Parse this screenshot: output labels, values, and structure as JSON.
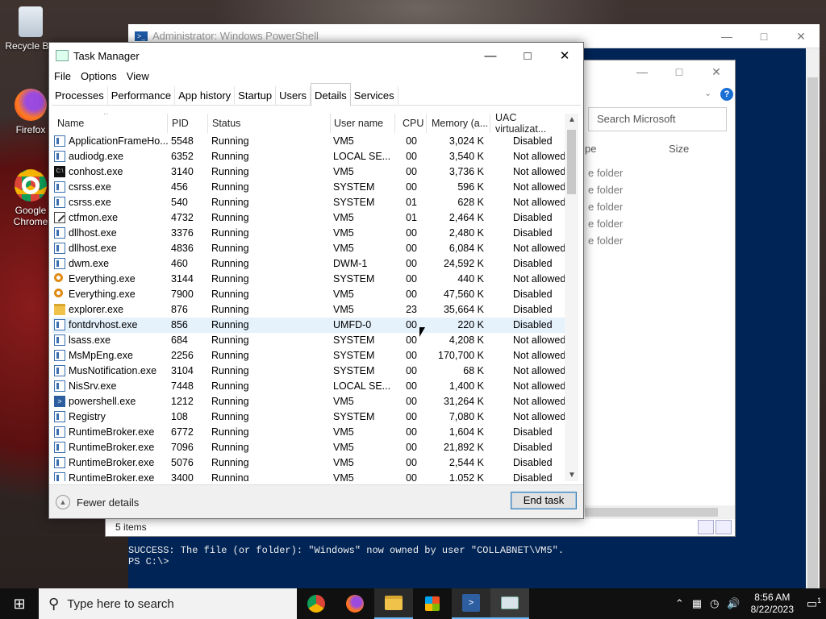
{
  "desktop": {
    "icons": [
      {
        "label": "Recycle Bin"
      },
      {
        "label": "Firefox"
      },
      {
        "label": "Google Chrome"
      }
    ]
  },
  "powershell": {
    "title": "Administrator: Windows PowerShell",
    "output_line1": "SUCCESS: The file (or folder): \"Windows\" now owned by user \"COLLABNET\\VM5\".",
    "output_line2": "PS C:\\>"
  },
  "explorer": {
    "search_placeholder": "Search Microsoft",
    "col_type": "pe",
    "col_size": "Size",
    "rows": [
      "e folder",
      "e folder",
      "e folder",
      "e folder",
      "e folder"
    ],
    "status": "5 items"
  },
  "taskmanager": {
    "title": "Task Manager",
    "menu": [
      "File",
      "Options",
      "View"
    ],
    "tabs": [
      "Processes",
      "Performance",
      "App history",
      "Startup",
      "Users",
      "Details",
      "Services"
    ],
    "active_tab": "Details",
    "columns": [
      "Name",
      "PID",
      "Status",
      "User name",
      "CPU",
      "Memory (a...",
      "UAC virtualizat..."
    ],
    "rows": [
      {
        "icon": "app",
        "name": "ApplicationFrameHo...",
        "pid": "5548",
        "status": "Running",
        "user": "VM5",
        "cpu": "00",
        "mem": "3,024 K",
        "uac": "Disabled"
      },
      {
        "icon": "app",
        "name": "audiodg.exe",
        "pid": "6352",
        "status": "Running",
        "user": "LOCAL SE...",
        "cpu": "00",
        "mem": "3,540 K",
        "uac": "Not allowed"
      },
      {
        "icon": "cmd",
        "name": "conhost.exe",
        "pid": "3140",
        "status": "Running",
        "user": "VM5",
        "cpu": "00",
        "mem": "3,736 K",
        "uac": "Not allowed"
      },
      {
        "icon": "app",
        "name": "csrss.exe",
        "pid": "456",
        "status": "Running",
        "user": "SYSTEM",
        "cpu": "00",
        "mem": "596 K",
        "uac": "Not allowed"
      },
      {
        "icon": "app",
        "name": "csrss.exe",
        "pid": "540",
        "status": "Running",
        "user": "SYSTEM",
        "cpu": "01",
        "mem": "628 K",
        "uac": "Not allowed"
      },
      {
        "icon": "pen",
        "name": "ctfmon.exe",
        "pid": "4732",
        "status": "Running",
        "user": "VM5",
        "cpu": "01",
        "mem": "2,464 K",
        "uac": "Disabled"
      },
      {
        "icon": "app",
        "name": "dllhost.exe",
        "pid": "3376",
        "status": "Running",
        "user": "VM5",
        "cpu": "00",
        "mem": "2,480 K",
        "uac": "Disabled"
      },
      {
        "icon": "app",
        "name": "dllhost.exe",
        "pid": "4836",
        "status": "Running",
        "user": "VM5",
        "cpu": "00",
        "mem": "6,084 K",
        "uac": "Not allowed"
      },
      {
        "icon": "app",
        "name": "dwm.exe",
        "pid": "460",
        "status": "Running",
        "user": "DWM-1",
        "cpu": "00",
        "mem": "24,592 K",
        "uac": "Disabled"
      },
      {
        "icon": "mag",
        "name": "Everything.exe",
        "pid": "3144",
        "status": "Running",
        "user": "SYSTEM",
        "cpu": "00",
        "mem": "440 K",
        "uac": "Not allowed"
      },
      {
        "icon": "mag",
        "name": "Everything.exe",
        "pid": "7900",
        "status": "Running",
        "user": "VM5",
        "cpu": "00",
        "mem": "47,560 K",
        "uac": "Disabled"
      },
      {
        "icon": "fold",
        "name": "explorer.exe",
        "pid": "876",
        "status": "Running",
        "user": "VM5",
        "cpu": "23",
        "mem": "35,664 K",
        "uac": "Disabled"
      },
      {
        "icon": "app",
        "name": "fontdrvhost.exe",
        "pid": "856",
        "status": "Running",
        "user": "UMFD-0",
        "cpu": "00",
        "mem": "220 K",
        "uac": "Disabled",
        "highlight": true
      },
      {
        "icon": "app",
        "name": "lsass.exe",
        "pid": "684",
        "status": "Running",
        "user": "SYSTEM",
        "cpu": "00",
        "mem": "4,208 K",
        "uac": "Not allowed"
      },
      {
        "icon": "app",
        "name": "MsMpEng.exe",
        "pid": "2256",
        "status": "Running",
        "user": "SYSTEM",
        "cpu": "00",
        "mem": "170,700 K",
        "uac": "Not allowed"
      },
      {
        "icon": "app",
        "name": "MusNotification.exe",
        "pid": "3104",
        "status": "Running",
        "user": "SYSTEM",
        "cpu": "00",
        "mem": "68 K",
        "uac": "Not allowed"
      },
      {
        "icon": "app",
        "name": "NisSrv.exe",
        "pid": "7448",
        "status": "Running",
        "user": "LOCAL SE...",
        "cpu": "00",
        "mem": "1,400 K",
        "uac": "Not allowed"
      },
      {
        "icon": "ps",
        "name": "powershell.exe",
        "pid": "1212",
        "status": "Running",
        "user": "VM5",
        "cpu": "00",
        "mem": "31,264 K",
        "uac": "Not allowed"
      },
      {
        "icon": "app",
        "name": "Registry",
        "pid": "108",
        "status": "Running",
        "user": "SYSTEM",
        "cpu": "00",
        "mem": "7,080 K",
        "uac": "Not allowed"
      },
      {
        "icon": "app",
        "name": "RuntimeBroker.exe",
        "pid": "6772",
        "status": "Running",
        "user": "VM5",
        "cpu": "00",
        "mem": "1,604 K",
        "uac": "Disabled"
      },
      {
        "icon": "app",
        "name": "RuntimeBroker.exe",
        "pid": "7096",
        "status": "Running",
        "user": "VM5",
        "cpu": "00",
        "mem": "21,892 K",
        "uac": "Disabled"
      },
      {
        "icon": "app",
        "name": "RuntimeBroker.exe",
        "pid": "5076",
        "status": "Running",
        "user": "VM5",
        "cpu": "00",
        "mem": "2,544 K",
        "uac": "Disabled"
      },
      {
        "icon": "app",
        "name": "RuntimeBroker.exe",
        "pid": "3400",
        "status": "Running",
        "user": "VM5",
        "cpu": "00",
        "mem": "1,052 K",
        "uac": "Disabled"
      }
    ],
    "fewer_details": "Fewer details",
    "end_task": "End task"
  },
  "taskbar": {
    "search_placeholder": "Type here to search",
    "apps": [
      "chrome-icon",
      "firefox-icon",
      "file-explorer-icon",
      "store-icon",
      "powershell-icon",
      "task-manager-icon"
    ],
    "time": "8:56 AM",
    "date": "8/22/2023",
    "notification_count": "1"
  }
}
